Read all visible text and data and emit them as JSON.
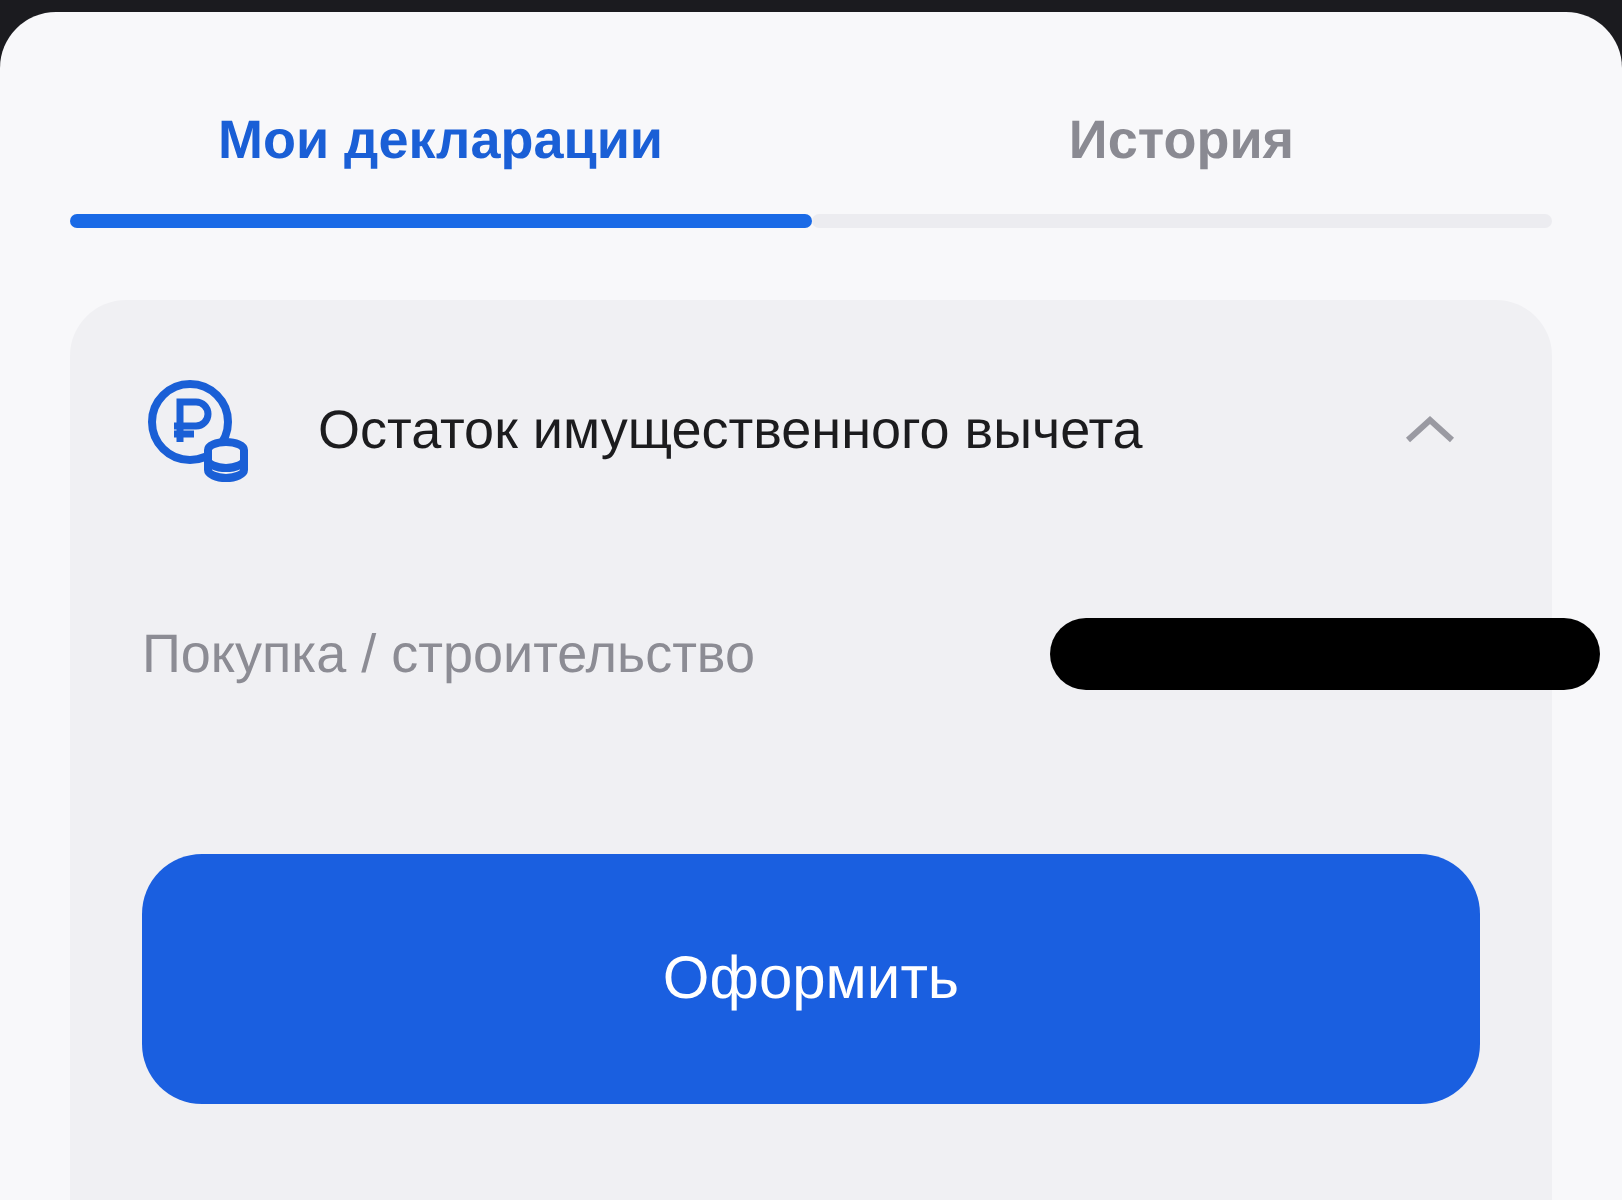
{
  "tabs": [
    {
      "label": "Мои декларации",
      "selected": true
    },
    {
      "label": "История",
      "selected": false
    }
  ],
  "card": {
    "title": "Остаток имущественного вычета",
    "expanded": true,
    "rows": [
      {
        "label": "Покупка / строительство",
        "redacted": true
      }
    ],
    "button": "Оформить"
  }
}
